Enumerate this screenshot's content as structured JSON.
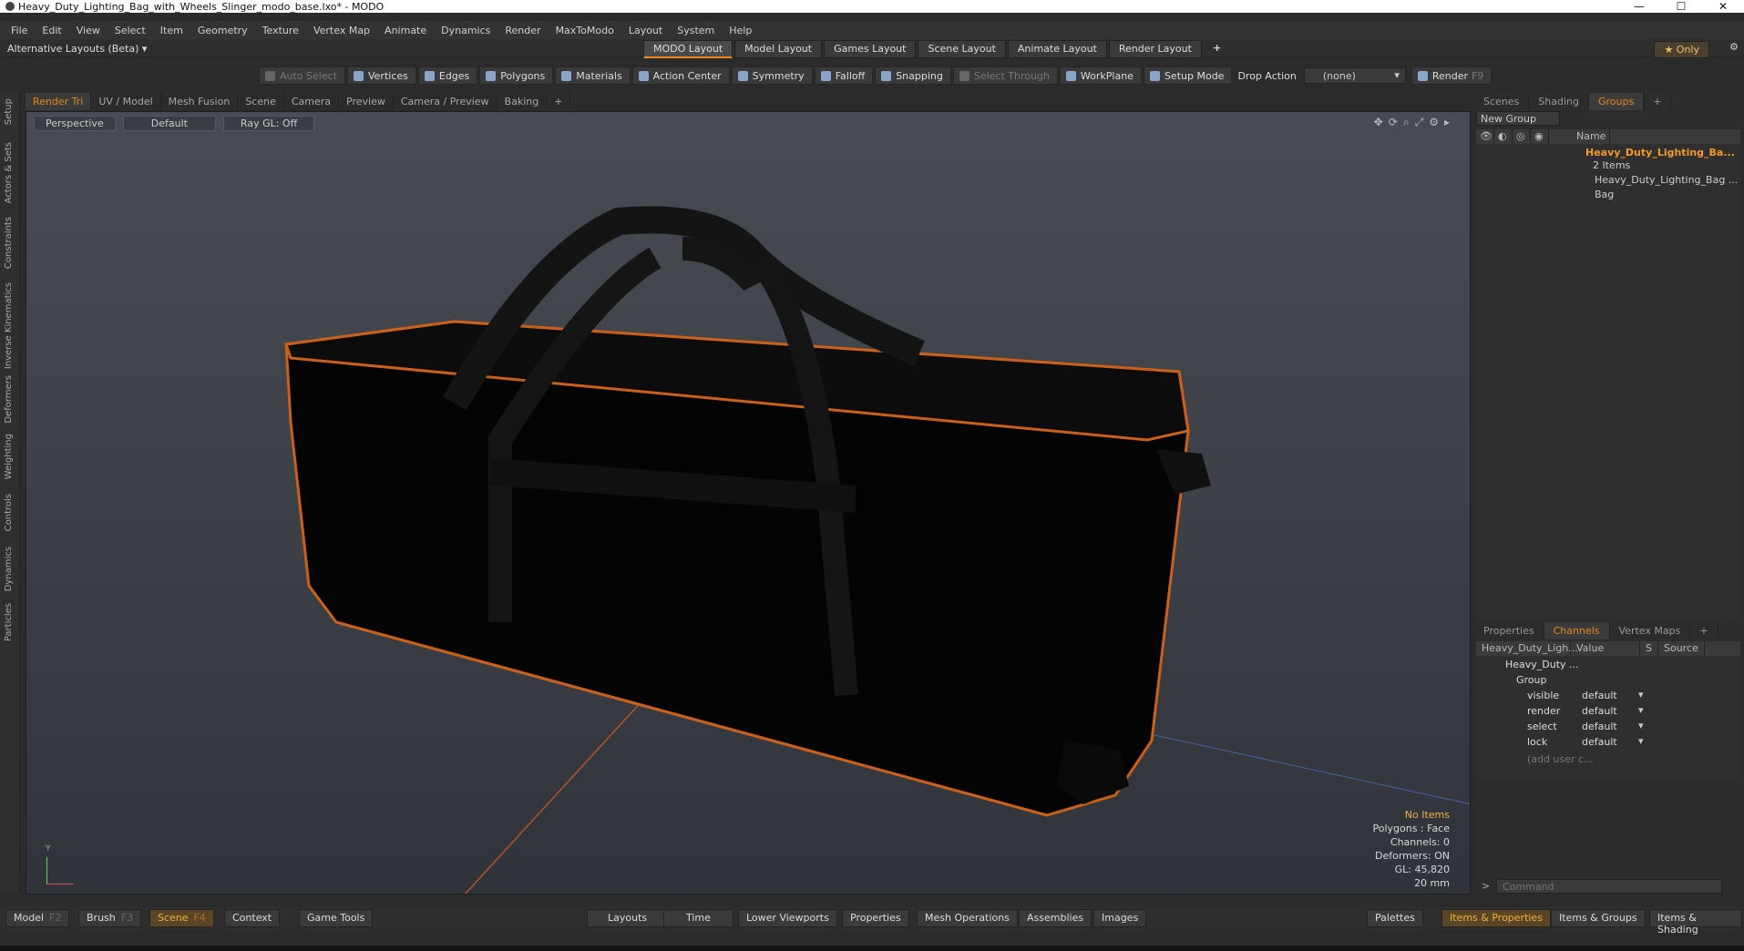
{
  "window": {
    "title": "Heavy_Duty_Lighting_Bag_with_Wheels_Slinger_modo_base.lxo* - MODO",
    "controls": [
      "—",
      "☐",
      "✕"
    ]
  },
  "menu": [
    "File",
    "Edit",
    "View",
    "Select",
    "Item",
    "Geometry",
    "Texture",
    "Vertex Map",
    "Animate",
    "Dynamics",
    "Render",
    "MaxToModo",
    "Layout",
    "System",
    "Help"
  ],
  "layouts": {
    "alternative": "Alternative Layouts (Beta)",
    "tabs": [
      "MODO Layout",
      "Model Layout",
      "Games Layout",
      "Scene Layout",
      "Animate Layout",
      "Render Layout"
    ],
    "add": "+",
    "only": "Only"
  },
  "toolbar": {
    "auto_select": "Auto Select",
    "vertices": "Vertices",
    "edges": "Edges",
    "polygons": "Polygons",
    "materials": "Materials",
    "action_center": "Action Center",
    "symmetry": "Symmetry",
    "falloff": "Falloff",
    "snapping": "Snapping",
    "select_through": "Select Through",
    "workplane": "WorkPlane",
    "setup_mode": "Setup Mode",
    "drop_action": "Drop Action",
    "drop_value": "(none)",
    "render": "Render",
    "render_key": "F9"
  },
  "left_rail": [
    "Setup",
    "Actors & Sets",
    "Constraints",
    "Inverse Kinematics",
    "Deformers",
    "Weighting",
    "Controls",
    "Dynamics",
    "Particles"
  ],
  "viewport_tabs": [
    "Render Tri",
    "UV / Model",
    "Mesh Fusion",
    "Scene",
    "Camera",
    "Preview",
    "Camera / Preview",
    "Baking",
    "+"
  ],
  "viewport": {
    "view": "Perspective",
    "shading": "Default",
    "raygl": "Ray GL: Off",
    "info": {
      "items": "No Items",
      "polygons": "Polygons : Face",
      "channels": "Channels: 0",
      "deformers": "Deformers: ON",
      "gl": "GL: 45,820",
      "scale": "20 mm"
    },
    "axis_y": "Y"
  },
  "right_tabs": [
    "Scenes",
    "Shading",
    "Groups",
    "+"
  ],
  "groups": {
    "new_group": "New Group",
    "name_header": "Name",
    "group_name": "Heavy_Duty_Lighting_Ba...",
    "count": "2 Items",
    "children": [
      "Heavy_Duty_Lighting_Bag ...",
      "Bag"
    ]
  },
  "channel_tabs": [
    "Properties",
    "Channels",
    "Vertex Maps",
    "+"
  ],
  "channels": {
    "headers": [
      "Heavy_Duty_Ligh...",
      "Value",
      "S",
      "Source"
    ],
    "item": "Heavy_Duty ...",
    "group": "Group",
    "rows": [
      {
        "name": "visible",
        "value": "default"
      },
      {
        "name": "render",
        "value": "default"
      },
      {
        "name": "select",
        "value": "default"
      },
      {
        "name": "lock",
        "value": "default"
      }
    ],
    "add": "(add user c..."
  },
  "command": {
    "placeholder": "Command"
  },
  "bottom": {
    "model": "Model",
    "model_key": "F2",
    "brush": "Brush",
    "brush_key": "F3",
    "scene": "Scene",
    "scene_key": "F4",
    "context": "Context",
    "game_tools": "Game Tools",
    "layouts": "Layouts",
    "time": "Time",
    "lower_viewports": "Lower Viewports",
    "properties": "Properties",
    "mesh_operations": "Mesh Operations",
    "assemblies": "Assemblies",
    "images": "Images",
    "palettes": "Palettes",
    "items_properties": "Items & Properties",
    "items_groups": "Items & Groups",
    "items_shading": "Items & Shading"
  },
  "colors": {
    "accent": "#e6891f",
    "bag_trim": "#c9601c",
    "bag_body": "#050505"
  }
}
